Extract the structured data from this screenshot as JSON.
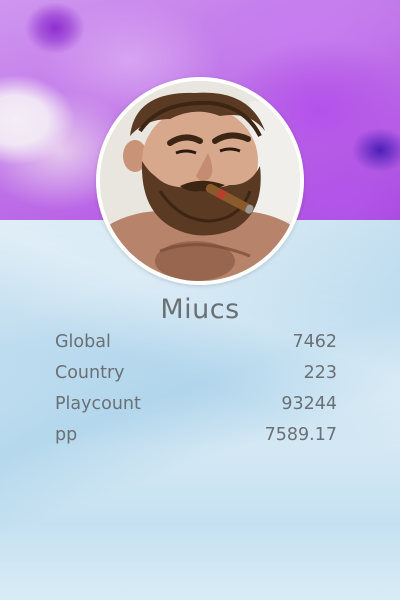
{
  "profile": {
    "username": "Miucs",
    "avatar_icon": "bearded-man-with-cigar-avatar"
  },
  "stats": [
    {
      "label": "Global",
      "value": "7462"
    },
    {
      "label": "Country",
      "value": "223"
    },
    {
      "label": "Playcount",
      "value": "93244"
    },
    {
      "label": "pp",
      "value": "7589.17"
    }
  ],
  "colors": {
    "banner": "#c27ae9",
    "background": "#cfe5f2",
    "text": "#6b7074",
    "avatar_border": "#ffffff"
  }
}
